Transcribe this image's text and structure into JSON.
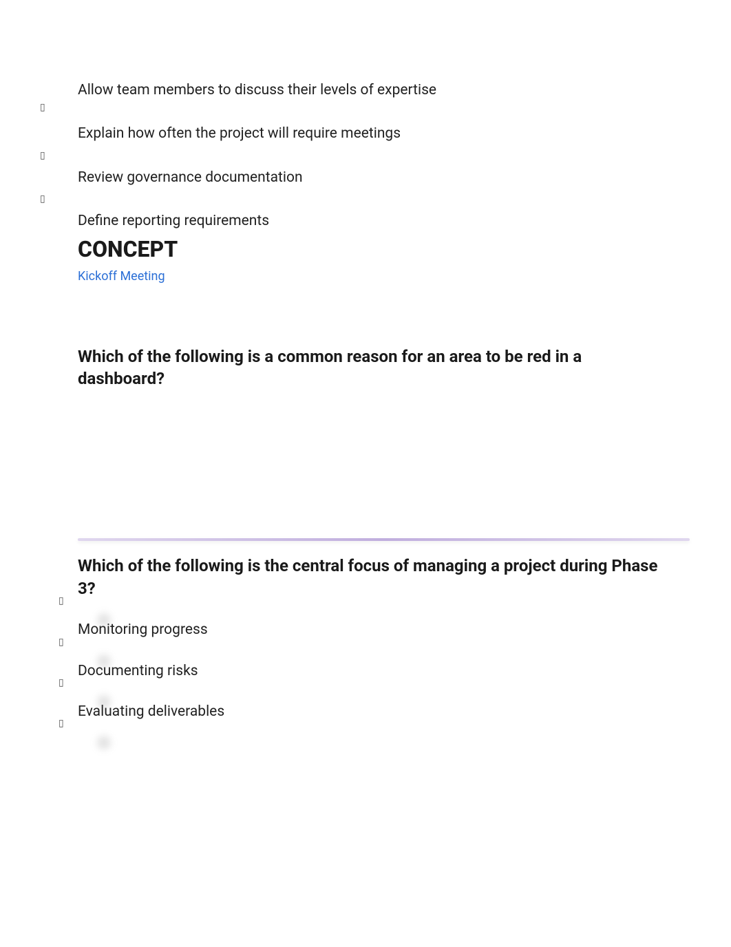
{
  "q1": {
    "options": [
      "Allow team members to discuss their levels of expertise",
      "Explain how often the project will require meetings",
      "Review governance documentation",
      "Define reporting requirements"
    ]
  },
  "concept": {
    "heading": "CONCEPT",
    "link": "Kickoff Meeting"
  },
  "q2": {
    "text": "Which of the following is a common reason for an area to be red in a dashboard?"
  },
  "q3": {
    "text": "Which of the following is the central focus of managing a project during Phase 3?",
    "options": [
      "Monitoring progress",
      "Documenting risks",
      "Evaluating deliverables"
    ]
  },
  "glyphs": {
    "bullet": "▯"
  }
}
